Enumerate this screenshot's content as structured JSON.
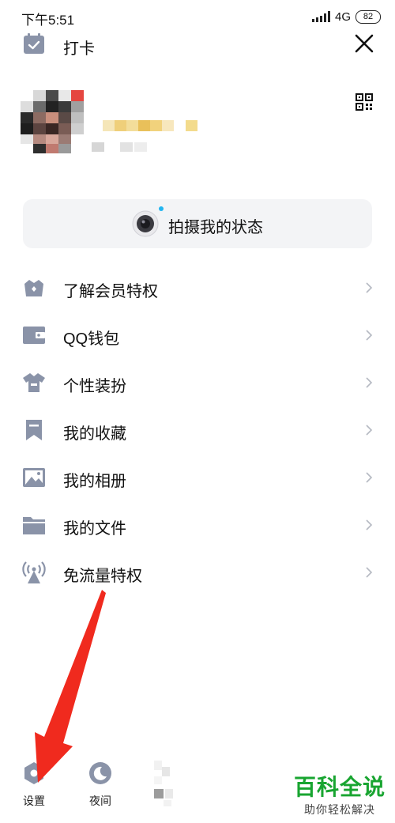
{
  "status_bar": {
    "time": "下午5:51",
    "network": "4G",
    "battery": "82"
  },
  "header": {
    "checkin_label": "打卡",
    "checkin_icon": "calendar-check-icon",
    "close_icon": "close-icon"
  },
  "profile": {
    "qr_icon": "qr-code-icon"
  },
  "capture": {
    "label": "拍摄我的状态",
    "icon": "camera-icon",
    "dot_color": "#22b5f0"
  },
  "menu": {
    "items": [
      {
        "label": "了解会员特权",
        "icon": "crown-icon"
      },
      {
        "label": "QQ钱包",
        "icon": "wallet-icon"
      },
      {
        "label": "个性装扮",
        "icon": "shirt-icon"
      },
      {
        "label": "我的收藏",
        "icon": "bookmark-icon"
      },
      {
        "label": "我的相册",
        "icon": "photo-icon"
      },
      {
        "label": "我的文件",
        "icon": "folder-icon"
      },
      {
        "label": "免流量特权",
        "icon": "signal-tower-icon"
      }
    ]
  },
  "bottom_bar": {
    "settings_label": "设置",
    "night_label": "夜间"
  },
  "watermark": {
    "title": "百科全说",
    "subtitle": "助你轻松解决"
  },
  "colors": {
    "icon_gray": "#8a93a8",
    "arrow_red": "#f02a1e",
    "brand_green": "#19a531"
  }
}
